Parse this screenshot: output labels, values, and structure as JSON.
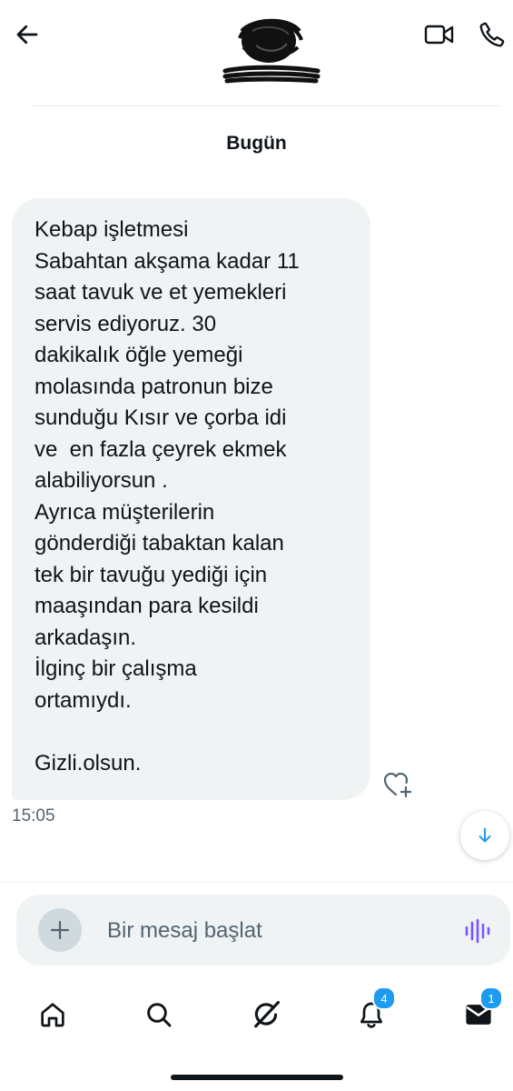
{
  "header": {
    "back_icon": "arrow-left-icon",
    "video_icon": "video-camera-icon",
    "phone_icon": "phone-icon"
  },
  "conversation": {
    "date_separator": "Bugün",
    "message": {
      "text": "Kebap işletmesi\nSabahtan akşama kadar 11\nsaat tavuk ve et yemekleri\nservis ediyoruz. 30\ndakikalık öğle yemeği\nmolasında patronun bize\nsunduğu Kısır ve çorba idi\nve  en fazla çeyrek ekmek\nalabiliyorsun .\nAyrıca müşterilerin\ngönderdiği tabaktan kalan\ntek bir tavuğu yediği için\nmaaşından para kesildi\narkadaşın.\nİlginç bir çalışma\nortamıydı.\n\nGizli.olsun.",
      "time": "15:05",
      "react_icon": "heart-plus-icon"
    },
    "scroll_down_icon": "arrow-down-icon"
  },
  "composer": {
    "placeholder": "Bir mesaj başlat",
    "value": "",
    "plus_icon": "plus-icon",
    "voice_icon": "waveform-icon"
  },
  "tabbar": {
    "items": [
      {
        "name": "home",
        "icon": "home-icon"
      },
      {
        "name": "search",
        "icon": "search-icon"
      },
      {
        "name": "grok",
        "icon": "grok-icon"
      },
      {
        "name": "notifications",
        "icon": "bell-icon",
        "badge": "4"
      },
      {
        "name": "messages",
        "icon": "envelope-icon",
        "badge": "1"
      }
    ]
  },
  "colors": {
    "accent": "#1d9bf0",
    "bubble": "#eff3f4",
    "text": "#0f1419",
    "secondary_text": "#536471",
    "voice_icon": "#7856ff"
  }
}
